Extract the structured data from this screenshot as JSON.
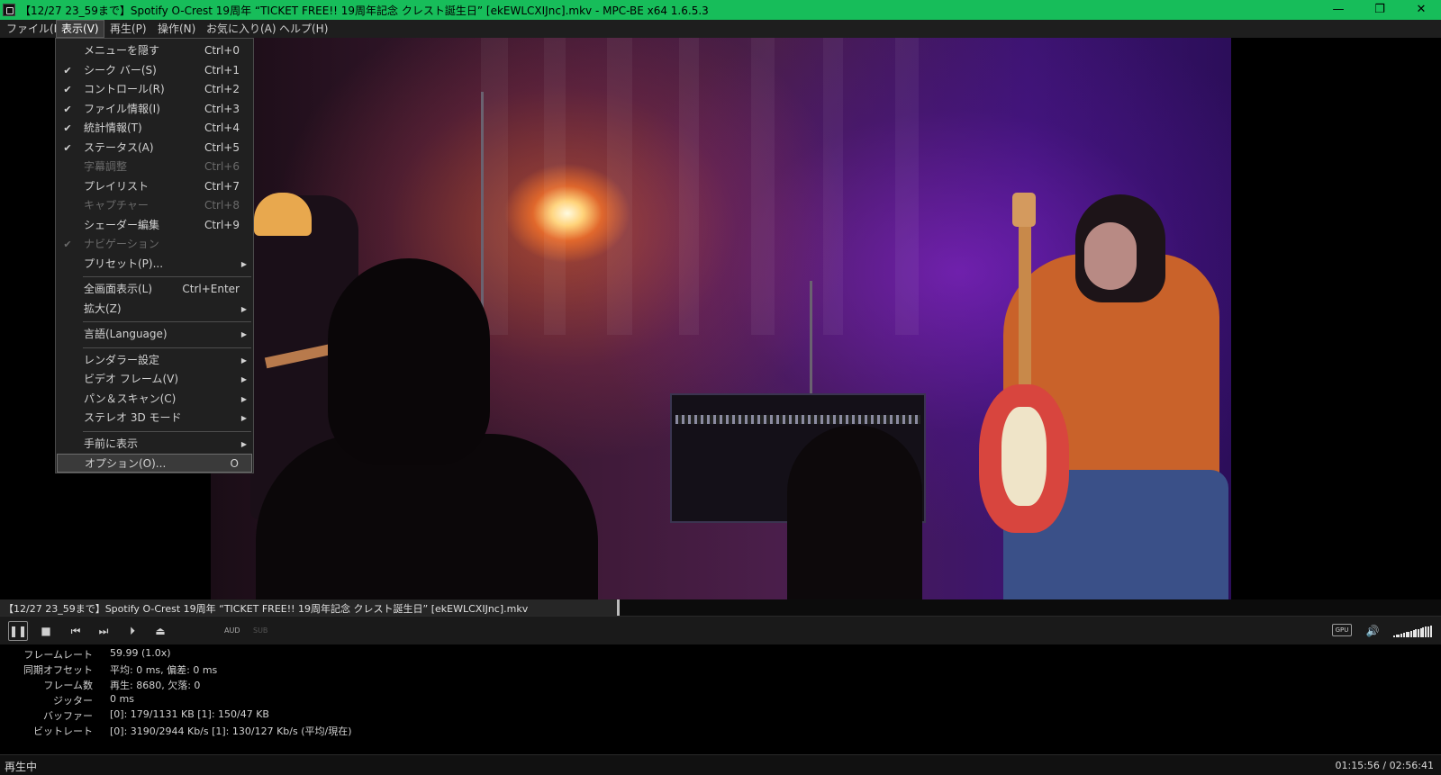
{
  "window": {
    "title": "【12/27 23_59まで】Spotify O-Crest 19周年 “TICKET FREE!! 19周年記念 クレスト誕生日” [ekEWLCXIJnc].mkv - MPC-BE x64 1.6.5.3",
    "minimize": "—",
    "restore": "❐",
    "close": "✕",
    "accent_color": "#17bd5a"
  },
  "menubar": {
    "items": [
      "ファイル(F)",
      "表示(V)",
      "再生(P)",
      "操作(N)",
      "お気に入り(A)",
      "ヘルプ(H)"
    ],
    "active_index": 1
  },
  "view_menu": {
    "items": [
      {
        "label": "メニューを隠す",
        "shortcut": "Ctrl+0",
        "checked": false,
        "disabled": false,
        "submenu": false
      },
      {
        "label": "シーク バー(S)",
        "shortcut": "Ctrl+1",
        "checked": true,
        "disabled": false,
        "submenu": false
      },
      {
        "label": "コントロール(R)",
        "shortcut": "Ctrl+2",
        "checked": true,
        "disabled": false,
        "submenu": false
      },
      {
        "label": "ファイル情報(I)",
        "shortcut": "Ctrl+3",
        "checked": true,
        "disabled": false,
        "submenu": false
      },
      {
        "label": "統計情報(T)",
        "shortcut": "Ctrl+4",
        "checked": true,
        "disabled": false,
        "submenu": false
      },
      {
        "label": "ステータス(A)",
        "shortcut": "Ctrl+5",
        "checked": true,
        "disabled": false,
        "submenu": false
      },
      {
        "label": "字幕調整",
        "shortcut": "Ctrl+6",
        "checked": false,
        "disabled": true,
        "submenu": false
      },
      {
        "label": "プレイリスト",
        "shortcut": "Ctrl+7",
        "checked": false,
        "disabled": false,
        "submenu": false
      },
      {
        "label": "キャプチャー",
        "shortcut": "Ctrl+8",
        "checked": false,
        "disabled": true,
        "submenu": false
      },
      {
        "label": "シェーダー編集",
        "shortcut": "Ctrl+9",
        "checked": false,
        "disabled": false,
        "submenu": false
      },
      {
        "label": "ナビゲーション",
        "shortcut": "",
        "checked": true,
        "disabled": true,
        "submenu": false
      },
      {
        "label": "プリセット(P)...",
        "shortcut": "",
        "checked": false,
        "disabled": false,
        "submenu": true
      },
      {
        "label": "全画面表示(L)",
        "shortcut": "Ctrl+Enter",
        "checked": false,
        "disabled": false,
        "submenu": false
      },
      {
        "label": "拡大(Z)",
        "shortcut": "",
        "checked": false,
        "disabled": false,
        "submenu": true
      },
      {
        "label": "言語(Language)",
        "shortcut": "",
        "checked": false,
        "disabled": false,
        "submenu": true
      },
      {
        "label": "レンダラー設定",
        "shortcut": "",
        "checked": false,
        "disabled": false,
        "submenu": true
      },
      {
        "label": "ビデオ フレーム(V)",
        "shortcut": "",
        "checked": false,
        "disabled": false,
        "submenu": true
      },
      {
        "label": "パン＆スキャン(C)",
        "shortcut": "",
        "checked": false,
        "disabled": false,
        "submenu": true
      },
      {
        "label": "ステレオ 3D モード",
        "shortcut": "",
        "checked": false,
        "disabled": false,
        "submenu": true
      },
      {
        "label": "手前に表示",
        "shortcut": "",
        "checked": false,
        "disabled": false,
        "submenu": true
      },
      {
        "label": "オプション(O)...",
        "shortcut": "O",
        "checked": false,
        "disabled": false,
        "submenu": false,
        "selected": true
      }
    ]
  },
  "seekbar": {
    "filename": "【12/27 23_59まで】Spotify O-Crest 19周年 “TICKET FREE!! 19周年記念 クレスト誕生日” [ekEWLCXIJnc].mkv",
    "progress": 0.43
  },
  "controls": {
    "pause": "❚❚",
    "stop": "■",
    "prev": "⏮",
    "next": "⏭",
    "frame_step": "⏵",
    "eject": "⏏",
    "aud": "AUD",
    "sub": "SUB",
    "gpu": "GPU",
    "volume_icon": "🔊",
    "volume_level": 1.0
  },
  "stats": [
    {
      "label": "フレームレート",
      "value": "59.99  (1.0x)"
    },
    {
      "label": "同期オフセット",
      "value": "平均: 0 ms, 偏差: 0 ms"
    },
    {
      "label": "フレーム数",
      "value": "再生: 8680, 欠落: 0"
    },
    {
      "label": "ジッター",
      "value": "0 ms"
    },
    {
      "label": "バッファー",
      "value": "[0]: 179/1131 KB [1]: 150/47 KB"
    },
    {
      "label": "ビットレート",
      "value": "[0]: 3190/2944 Kb/s [1]: 130/127 Kb/s (平均/現在)"
    }
  ],
  "status": {
    "state": "再生中",
    "time": "01:15:56 / 02:56:41"
  }
}
